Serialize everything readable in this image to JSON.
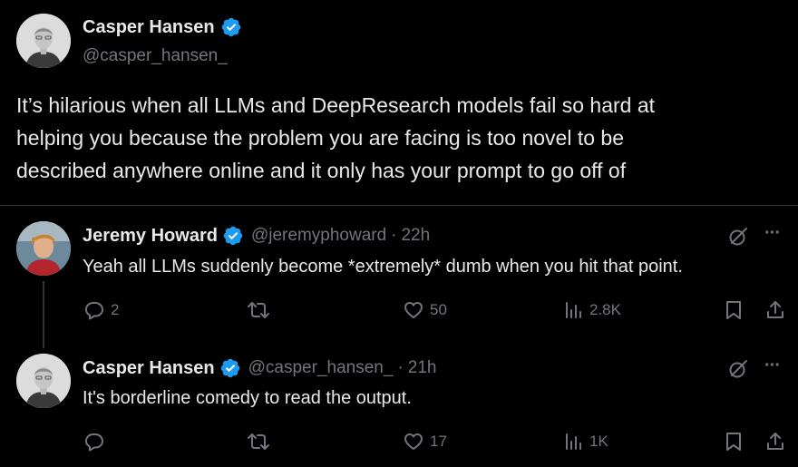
{
  "main_tweet": {
    "author_name": "Casper Hansen",
    "handle": "@casper_hansen_",
    "text_lines": [
      "It’s hilarious when all LLMs and DeepResearch models fail so hard at",
      "helping you because the problem you are facing is too novel to be",
      "described anywhere online and it only has your prompt to go off of"
    ]
  },
  "replies": [
    {
      "author_name": "Jeremy Howard",
      "handle": "@jeremyphoward",
      "separator": "·",
      "time": "22h",
      "text": "Yeah all LLMs suddenly become *extremely* dumb when you hit that point.",
      "reply_count": "2",
      "retweet_count": "",
      "like_count": "50",
      "view_count": "2.8K",
      "more_label": "···"
    },
    {
      "author_name": "Casper Hansen",
      "handle": "@casper_hansen_",
      "separator": "·",
      "time": "21h",
      "text": "It's borderline comedy to read the output.",
      "reply_count": "",
      "retweet_count": "",
      "like_count": "17",
      "view_count": "1K",
      "more_label": "···"
    }
  ],
  "colors": {
    "background": "#000000",
    "text": "#e7e9ea",
    "muted": "#71767b",
    "verified": "#1d9bf0",
    "divider": "#2f3336"
  },
  "icons": [
    "verified-badge-icon",
    "grok-icon",
    "more-icon",
    "reply-icon",
    "retweet-icon",
    "like-icon",
    "views-icon",
    "bookmark-icon",
    "share-icon"
  ]
}
